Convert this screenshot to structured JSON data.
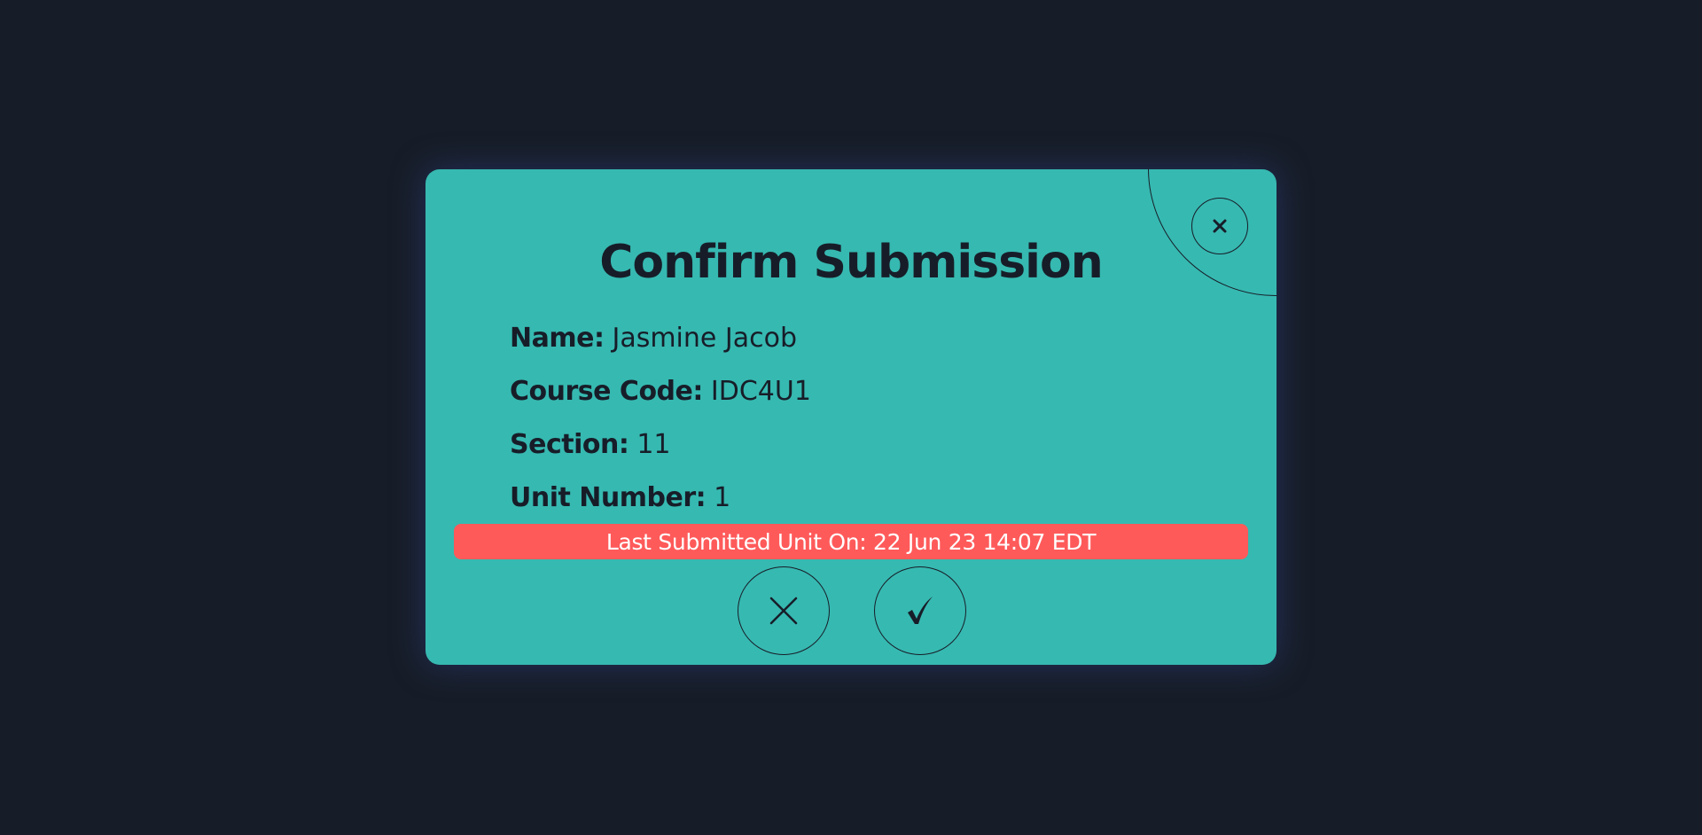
{
  "dialog": {
    "title": "Confirm Submission",
    "close_icon": "close-icon",
    "fields": [
      {
        "label": "Name:",
        "value": "Jasmine Jacob"
      },
      {
        "label": "Course Code:",
        "value": "IDC4U1"
      },
      {
        "label": "Section:",
        "value": "11"
      },
      {
        "label": "Unit Number:",
        "value": "1"
      }
    ],
    "last_submitted": "Last Submitted Unit On: 22 Jun 23 14:07 EDT",
    "cancel_icon": "x-icon",
    "confirm_icon": "check-icon"
  },
  "colors": {
    "background": "#171d28",
    "dialog": "#36b9b1",
    "banner": "#ff5a5a",
    "text": "#171d28",
    "banner_text": "#ffffff"
  }
}
